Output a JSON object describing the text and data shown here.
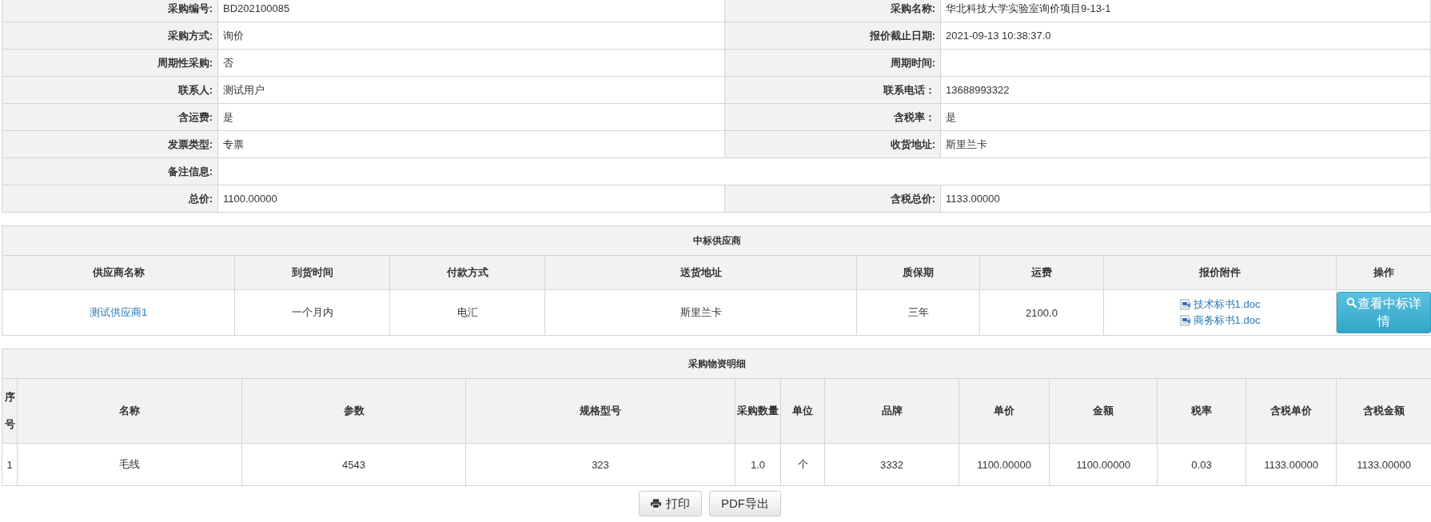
{
  "info_rows": [
    [
      {
        "label": "采购编号:",
        "value": "BD202100085"
      },
      {
        "label": "采购名称:",
        "value": "华北科技大学实验室询价项目9-13-1"
      }
    ],
    [
      {
        "label": "采购方式:",
        "value": "询价"
      },
      {
        "label": "报价截止日期:",
        "value": "2021-09-13 10:38:37.0"
      }
    ],
    [
      {
        "label": "周期性采购:",
        "value": "否"
      },
      {
        "label": "周期时间:"
      }
    ],
    [
      {
        "label": "联系人:",
        "value": "测试用户"
      },
      {
        "label": "联系电话：",
        "value": "13688993322"
      }
    ],
    [
      {
        "label": "含运费:",
        "value": "是"
      },
      {
        "label": "含税率：",
        "value": "是"
      }
    ],
    [
      {
        "label": "发票类型:",
        "value": "专票"
      },
      {
        "label": "收货地址:",
        "value": "斯里兰卡"
      }
    ],
    [
      {
        "label": "备注信息:"
      }
    ],
    [
      {
        "label": "总价:",
        "value": "1100.00000"
      },
      {
        "label": "含税总价:",
        "value": "1133.00000"
      }
    ]
  ],
  "supplier_table": {
    "title": "中标供应商",
    "columns": [
      "供应商名称",
      "到货时间",
      "付款方式",
      "送货地址",
      "质保期",
      "运费",
      "报价附件",
      "操作"
    ],
    "rows": [
      {
        "supplier": "测试供应商1",
        "arrival": "一个月内",
        "payment": "电汇",
        "address": "斯里兰卡",
        "warranty": "三年",
        "freight": "2100.0",
        "attachments": [
          "技术标书1.doc",
          "商务标书1.doc"
        ],
        "action": "查看中标详情"
      }
    ]
  },
  "materials_table": {
    "title": "采购物资明细",
    "columns": [
      "序号",
      "名称",
      "参数",
      "规格型号",
      "采购数量",
      "单位",
      "品牌",
      "单价",
      "金额",
      "税率",
      "含税单价",
      "含税金额"
    ],
    "rows": [
      [
        "1",
        "毛线",
        "4543",
        "323",
        "1.0",
        "个",
        "3332",
        "1100.00000",
        "1100.00000",
        "0.03",
        "1133.00000",
        "1133.00000"
      ]
    ]
  },
  "buttons": [
    {
      "label": "打印",
      "kind": "print"
    },
    {
      "label": "PDF导出",
      "kind": "plain"
    }
  ]
}
